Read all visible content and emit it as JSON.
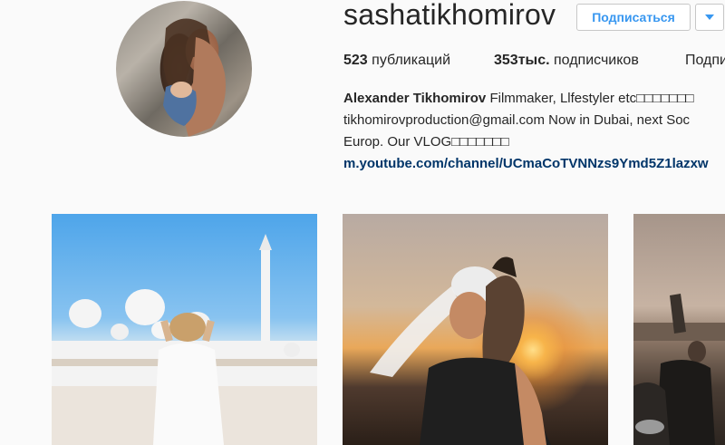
{
  "profile": {
    "username": "sashatikhomirov",
    "follow_label": "Подписаться"
  },
  "stats": {
    "posts_count": "523",
    "posts_label": "публикаций",
    "followers_count": "353тыс.",
    "followers_label": "подписчиков",
    "following_label": "Подпи"
  },
  "bio": {
    "name": "Alexander Tikhomirov",
    "line1_rest": "Filmmaker, Llfestyler etc□□□□□□□",
    "line2": "tikhomirovproduction@gmail.com Now in Dubai, next Soc",
    "line3": "Europ. Our VLOG□□□□□□□",
    "link": "m.youtube.com/channel/UCmaCoTVNNzs9Ymd5Z1lazxw"
  },
  "colors": {
    "accent": "#3897f0",
    "link": "#003569",
    "background": "#fafafa"
  },
  "icons": {
    "dropdown": "caret-down-icon"
  }
}
